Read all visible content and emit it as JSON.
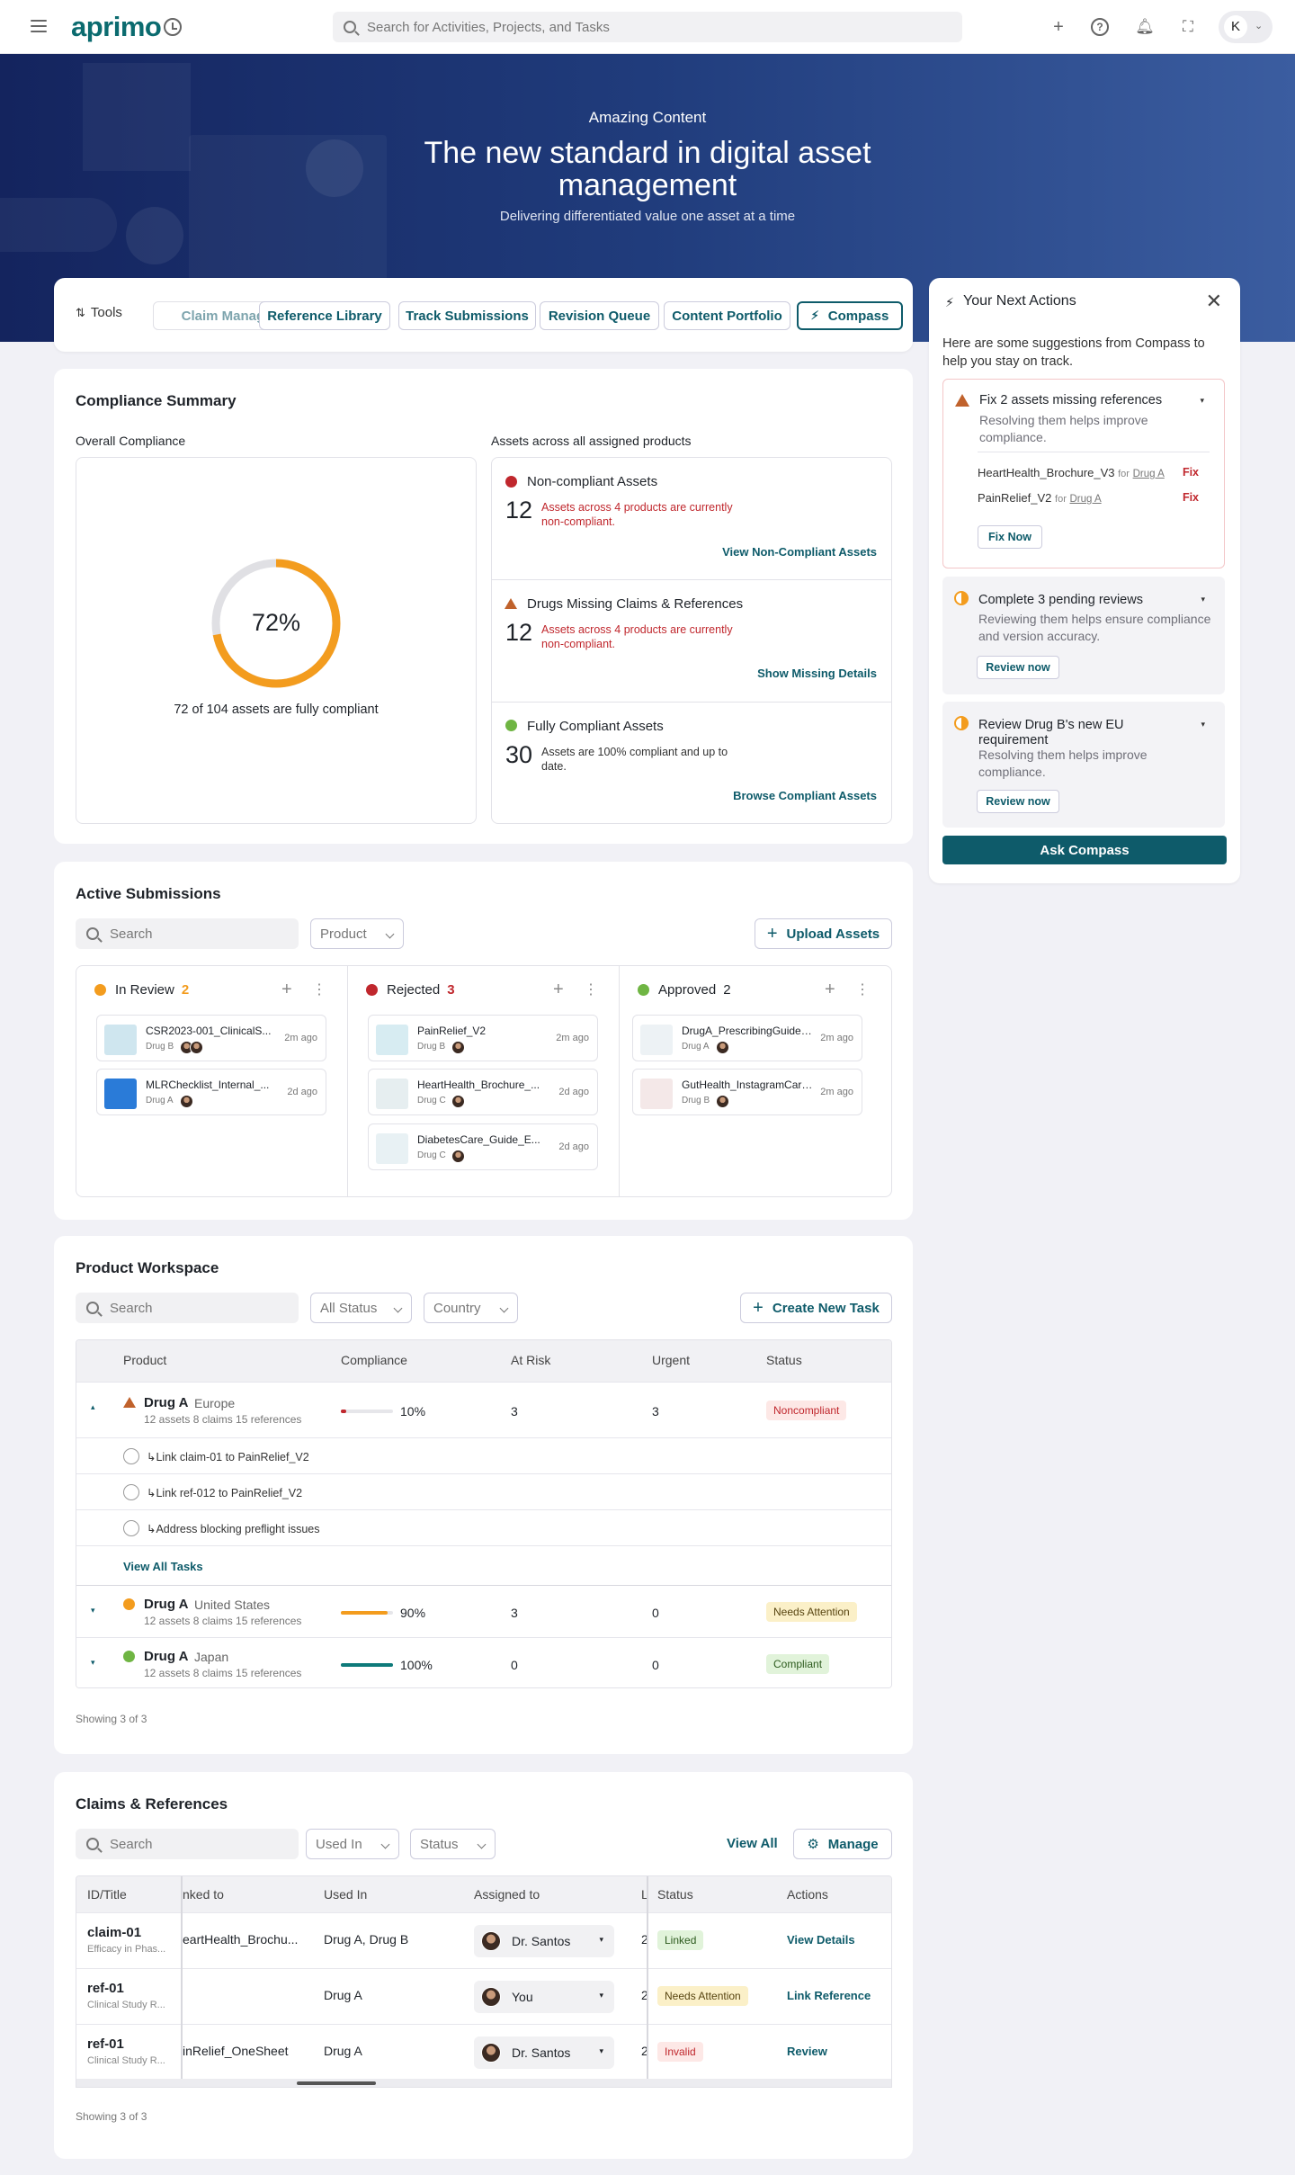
{
  "topbar": {
    "logo": "aprimo",
    "search_placeholder": "Search for Activities, Projects, and Tasks",
    "avatar_initial": "K"
  },
  "hero": {
    "eyebrow": "Amazing Content",
    "title": "The new standard in digital asset management",
    "subtitle": "Delivering differentiated value one asset at a time"
  },
  "tabs": {
    "tools_label": "Tools",
    "items": [
      "Claim Manager",
      "Reference Library",
      "Track Submissions",
      "Revision Queue",
      "Content Portfolio",
      "Compass"
    ]
  },
  "compliance": {
    "title": "Compliance Summary",
    "overall_label": "Overall Compliance",
    "percent_label": "72%",
    "percent_value": 72,
    "caption": "72 of 104 assets are fully compliant",
    "assets_label": "Assets across all assigned products",
    "cards": [
      {
        "title": "Non-compliant Assets",
        "number": "12",
        "desc": "Assets across 4 products are currently non-compliant.",
        "link": "View Non-Compliant Assets",
        "color": "#c0272d"
      },
      {
        "title": "Drugs Missing Claims & References",
        "number": "12",
        "desc": "Assets across 4 products are currently non-compliant.",
        "link": "Show Missing Details",
        "color": "#c0622c"
      },
      {
        "title": "Fully Compliant Assets",
        "number": "30",
        "desc": "Assets are 100% compliant and up to date.",
        "link": "Browse Compliant Assets",
        "color": "#6fb543"
      }
    ]
  },
  "submissions": {
    "title": "Active Submissions",
    "search_placeholder": "Search",
    "product_filter": "Product",
    "upload_label": "Upload Assets",
    "columns": [
      {
        "name": "In Review",
        "count": "2",
        "color": "#f39c1e",
        "count_color": "#f39c1e",
        "items": [
          {
            "name": "CSR2023-001_ClinicalS...",
            "drug": "Drug B",
            "time": "2m ago",
            "thumb": "#cfe6ef"
          },
          {
            "name": "MLRChecklist_Internal_...",
            "drug": "Drug A",
            "time": "2d ago",
            "thumb": "#2a7bd8"
          }
        ]
      },
      {
        "name": "Rejected",
        "count": "3",
        "color": "#c0272d",
        "count_color": "#c0272d",
        "items": [
          {
            "name": "PainRelief_V2",
            "drug": "Drug B",
            "time": "2m ago",
            "thumb": "#d7ecf2"
          },
          {
            "name": "HeartHealth_Brochure_...",
            "drug": "Drug C",
            "time": "2d ago",
            "thumb": "#e6eef0"
          },
          {
            "name": "DiabetesCare_Guide_E...",
            "drug": "Drug C",
            "time": "2d ago",
            "thumb": "#e8f1f4"
          }
        ]
      },
      {
        "name": "Approved",
        "count": "2",
        "color": "#6fb543",
        "count_color": "#1f2329",
        "items": [
          {
            "name": "DrugA_PrescribingGuide_V4",
            "drug": "Drug A",
            "time": "2m ago",
            "thumb": "#edf2f5"
          },
          {
            "name": "GutHealth_InstagramCarousel",
            "drug": "Drug B",
            "time": "2m ago",
            "thumb": "#f4e8e8"
          }
        ]
      }
    ]
  },
  "workspace": {
    "title": "Product Workspace",
    "search_placeholder": "Search",
    "status_filter": "All Status",
    "country_filter": "Country",
    "create_label": "Create New Task",
    "headers": [
      "Product",
      "Compliance",
      "At Risk",
      "Urgent",
      "Status"
    ],
    "rows": [
      {
        "drug": "Drug A",
        "region": "Europe",
        "meta": "12 assets 8 claims 15 references",
        "pct": "10%",
        "value": 10,
        "risk": "3",
        "urgent": "3",
        "status": "Noncompliant",
        "bar": "#c0272d"
      },
      {
        "drug": "Drug A",
        "region": "United States",
        "meta": "12 assets 8 claims 15 references",
        "pct": "90%",
        "value": 90,
        "risk": "3",
        "urgent": "0",
        "status": "Needs Attention",
        "bar": "#f39c1e"
      },
      {
        "drug": "Drug A",
        "region": "Japan",
        "meta": "12 assets 8 claims 15 references",
        "pct": "100%",
        "value": 100,
        "risk": "0",
        "urgent": "0",
        "status": "Compliant",
        "bar": "#0e7a7a"
      }
    ],
    "tasks": [
      "↳Link claim-01 to PainRelief_V2",
      "↳Link ref-012 to PainRelief_V2",
      "↳Address blocking preflight issues"
    ],
    "view_all_tasks": "View All Tasks",
    "showing": "Showing 3 of 3"
  },
  "claims": {
    "title": "Claims & References",
    "search_placeholder": "Search",
    "used_in_filter": "Used In",
    "status_filter": "Status",
    "view_all": "View All",
    "manage": "Manage",
    "headers": [
      "ID/Title",
      "nked to",
      "Used In",
      "Assigned to",
      "L",
      "Status",
      "Actions"
    ],
    "rows": [
      {
        "id": "claim-01",
        "sub": "Efficacy in Phas...",
        "linked": "eartHealth_Brochu...",
        "used": "Drug A, Drug B",
        "assigned": "Dr. Santos",
        "l": "2",
        "status": "Linked",
        "status_kind": "grn",
        "action": "View Details"
      },
      {
        "id": "ref-01",
        "sub": "Clinical Study R...",
        "linked": "",
        "used": "Drug A",
        "assigned": "You",
        "l": "2",
        "status": "Needs Attention",
        "status_kind": "yel",
        "action": "Link Reference"
      },
      {
        "id": "ref-01",
        "sub": "Clinical Study R...",
        "linked": "inRelief_OneSheet",
        "used": "Drug A",
        "assigned": "Dr. Santos",
        "l": "2",
        "status": "Invalid",
        "status_kind": "red",
        "action": "Review"
      }
    ],
    "showing": "Showing 3 of 3"
  },
  "next_actions": {
    "title": "Your Next Actions",
    "intro": "Here are some suggestions from Compass to help you stay on track.",
    "items": [
      {
        "title": "Fix 2 assets missing references",
        "desc": "Resolving them helps improve compliance.",
        "assets": [
          {
            "name": "HeartHealth_Brochure_V3",
            "for": "for",
            "drug": "Drug A",
            "fix": "Fix"
          },
          {
            "name": "PainRelief_V2",
            "for": "for",
            "drug": "Drug A",
            "fix": "Fix"
          }
        ],
        "button": "Fix Now"
      },
      {
        "title": "Complete 3 pending reviews",
        "desc": "Reviewing them helps ensure compliance and version accuracy.",
        "button": "Review now"
      },
      {
        "title": "Review Drug B's new EU requirement",
        "desc": "Resolving them helps improve compliance.",
        "button": "Review now"
      }
    ],
    "ask": "Ask Compass"
  }
}
